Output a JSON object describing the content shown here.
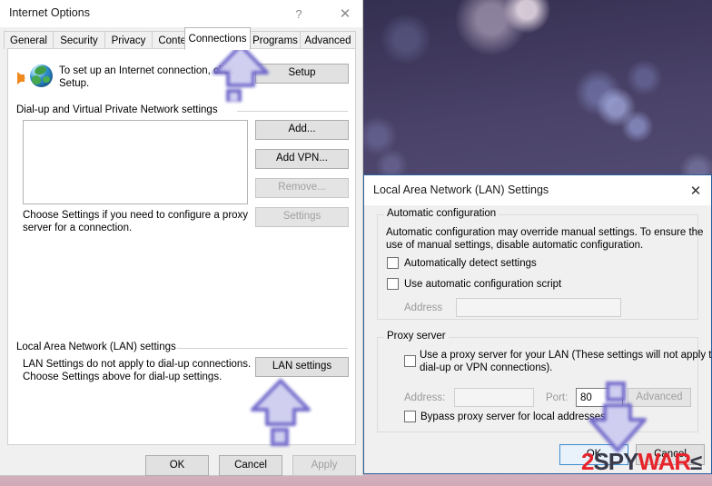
{
  "internet_options": {
    "title": "Internet Options",
    "help_icon": "?",
    "close_icon": "✕",
    "tabs": [
      {
        "label": "General",
        "active": false
      },
      {
        "label": "Security",
        "active": false
      },
      {
        "label": "Privacy",
        "active": false
      },
      {
        "label": "Content",
        "active": false
      },
      {
        "label": "Connections",
        "active": true
      },
      {
        "label": "Programs",
        "active": false
      },
      {
        "label": "Advanced",
        "active": false
      }
    ],
    "setup": {
      "description": "To set up an Internet connection, click",
      "description_line2": "Setup.",
      "button_label": "Setup"
    },
    "dialup": {
      "group_label": "Dial-up and Virtual Private Network settings",
      "list_items": [],
      "buttons": [
        {
          "label": "Add...",
          "enabled": true
        },
        {
          "label": "Add VPN...",
          "enabled": true
        },
        {
          "label": "Remove...",
          "enabled": false
        },
        {
          "label": "Settings",
          "enabled": false
        }
      ],
      "hint_line1": "Choose Settings if you need to configure a proxy",
      "hint_line2": "server for a connection."
    },
    "lan_section": {
      "group_label": "Local Area Network (LAN) settings",
      "hint_line1": "LAN Settings do not apply to dial-up connections.",
      "hint_line2": "Choose Settings above for dial-up settings.",
      "button_label": "LAN settings"
    },
    "footer_buttons": [
      {
        "label": "OK",
        "enabled": true
      },
      {
        "label": "Cancel",
        "enabled": true
      },
      {
        "label": "Apply",
        "enabled": false
      }
    ]
  },
  "lan_settings": {
    "title": "Local Area Network (LAN) Settings",
    "close_icon": "✕",
    "automatic_configuration": {
      "group_label": "Automatic configuration",
      "description_line1": "Automatic configuration may override manual settings.  To ensure the",
      "description_line2": "use of manual settings, disable automatic configuration.",
      "auto_detect": {
        "label": "Automatically detect settings",
        "checked": false
      },
      "use_script": {
        "label": "Use automatic configuration script",
        "checked": false
      },
      "address_label": "Address",
      "address_value": "",
      "address_enabled": false
    },
    "proxy_server": {
      "group_label": "Proxy server",
      "use_proxy": {
        "label_line1": "Use a proxy server for your LAN (These settings will not apply to",
        "label_line2": "dial-up or VPN connections).",
        "checked": false
      },
      "address_label": "Address:",
      "address_value": "",
      "port_label": "Port:",
      "port_value": "80",
      "advanced_label": "Advanced",
      "advanced_enabled": false,
      "bypass": {
        "label": "Bypass proxy server for local addresses",
        "checked": false
      }
    },
    "footer_buttons": [
      {
        "label": "OK",
        "enabled": true,
        "focused": true
      },
      {
        "label": "Cancel",
        "enabled": true,
        "focused": false
      }
    ]
  },
  "annotations": {
    "arrow_color": "#6b63c8",
    "arrow_connections_tab": "up-arrow-pointing-to-connections-tab",
    "arrow_lan_settings": "up-arrow-pointing-to-lan-settings-button",
    "arrow_ok_button": "down-arrow-pointing-to-ok-button"
  },
  "watermark": {
    "part_1": "2",
    "part_2": "SPY",
    "part_3": "WAR",
    "part_4": "≤"
  }
}
